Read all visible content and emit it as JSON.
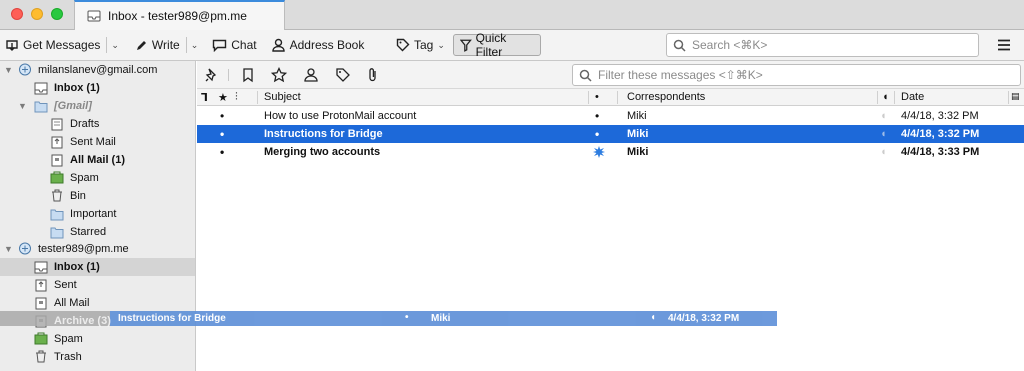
{
  "window": {
    "tab_title": "Inbox - tester989@pm.me",
    "traffic_colors": {
      "close": "#fe5f57",
      "minimize": "#febc2e",
      "maximize": "#28c840"
    }
  },
  "toolbar": {
    "get_messages": "Get Messages",
    "write": "Write",
    "chat": "Chat",
    "address_book": "Address Book",
    "tag": "Tag",
    "quick_filter": "Quick Filter",
    "search_placeholder": "Search <⌘K>"
  },
  "folders": {
    "accounts": [
      {
        "name": "milanslanev@gmail.com",
        "inbox": "Inbox (1)",
        "gmail": "[Gmail]",
        "items": [
          "Drafts",
          "Sent Mail",
          "All Mail (1)",
          "Spam",
          "Bin",
          "Important",
          "Starred"
        ]
      },
      {
        "name": "tester989@pm.me",
        "items": [
          "Inbox (1)",
          "Sent",
          "All Mail",
          "Archive (3)",
          "Spam",
          "Trash"
        ]
      }
    ]
  },
  "quickfilter": {
    "filter_placeholder": "Filter these messages <⇧⌘K>"
  },
  "columns": {
    "subject": "Subject",
    "correspondents": "Correspondents",
    "date": "Date"
  },
  "messages": [
    {
      "subject": "How to use ProtonMail account",
      "correspondent": "Miki",
      "date": "4/4/18, 3:32 PM"
    },
    {
      "subject": "Instructions for Bridge",
      "correspondent": "Miki",
      "date": "4/4/18, 3:32 PM"
    },
    {
      "subject": "Merging two accounts",
      "correspondent": "Miki",
      "date": "4/4/18, 3:33 PM"
    }
  ],
  "drag": {
    "subject": "Instructions for Bridge",
    "correspondent": "Miki",
    "date": "4/4/18, 3:32 PM"
  },
  "colors": {
    "selection": "#1d69d9",
    "accent_tab": "#3b8bdc"
  }
}
